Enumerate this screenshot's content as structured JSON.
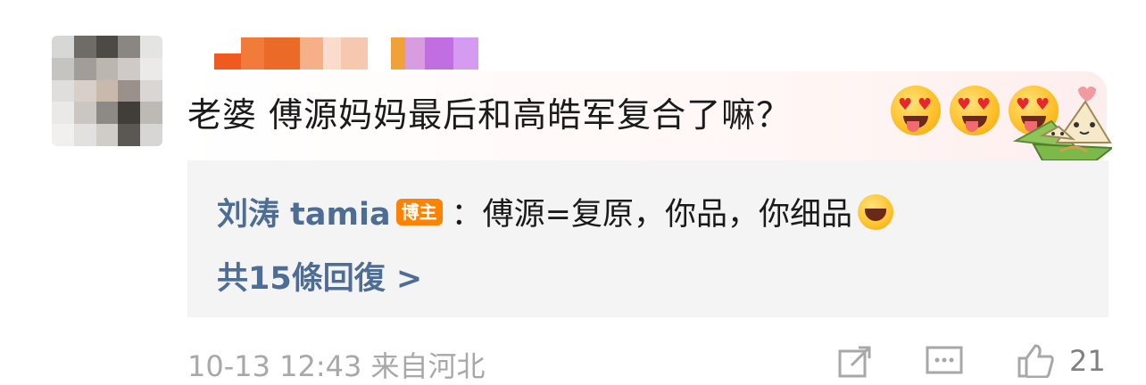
{
  "comment": {
    "text": "老婆 傅源妈妈最后和高皓军复合了嘛？",
    "emojis": [
      "heart-eyes-icon",
      "heart-eyes-icon",
      "heart-eyes-icon"
    ],
    "sticker": "zongzi-sticker-icon"
  },
  "reply": {
    "author": "刘涛 tamia",
    "badge": "博主",
    "text": "：傅源=复原，你品，你细品",
    "emoji": "grin-icon",
    "more_label": "共15條回復 >"
  },
  "footer": {
    "meta": "10-13 12:43 来自河北",
    "like_count": "21"
  }
}
